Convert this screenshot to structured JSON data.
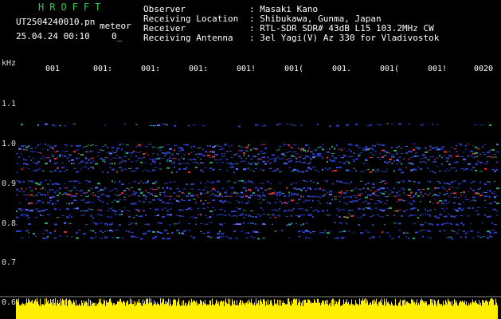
{
  "header": {
    "station": "HROFFT",
    "filename": "UT2504240010.pn",
    "mode": "meteor",
    "datetime": "25.04.24 00:10",
    "counter": "0_",
    "info_labels": [
      "Observer",
      "Receiving Location",
      "Receiver",
      "Receiving Antenna"
    ],
    "info_values": [
      ": Masaki Kano",
      ": Shibukawa, Gunma, Japan",
      ": RTL-SDR SDR# 43dB L15 103.2MHz CW",
      ": 3el Yagi(V) Az 330 for Vladivostok"
    ]
  },
  "axis": {
    "unit": "kHz",
    "y_ticks": [
      "1.1",
      "1.0",
      "0.9",
      "0.8",
      "0.7",
      "0.6"
    ],
    "x_ticks": [
      "001",
      "001:",
      "001:",
      "001:",
      "001!",
      "001(",
      "001.",
      "001(",
      "001!",
      "0020"
    ]
  },
  "colors": {
    "background": "#000000",
    "noise_fill": "#ffee00",
    "text_green": "#2fd24a",
    "band_blue": "#2a40c8",
    "band_red": "#e03030"
  }
}
